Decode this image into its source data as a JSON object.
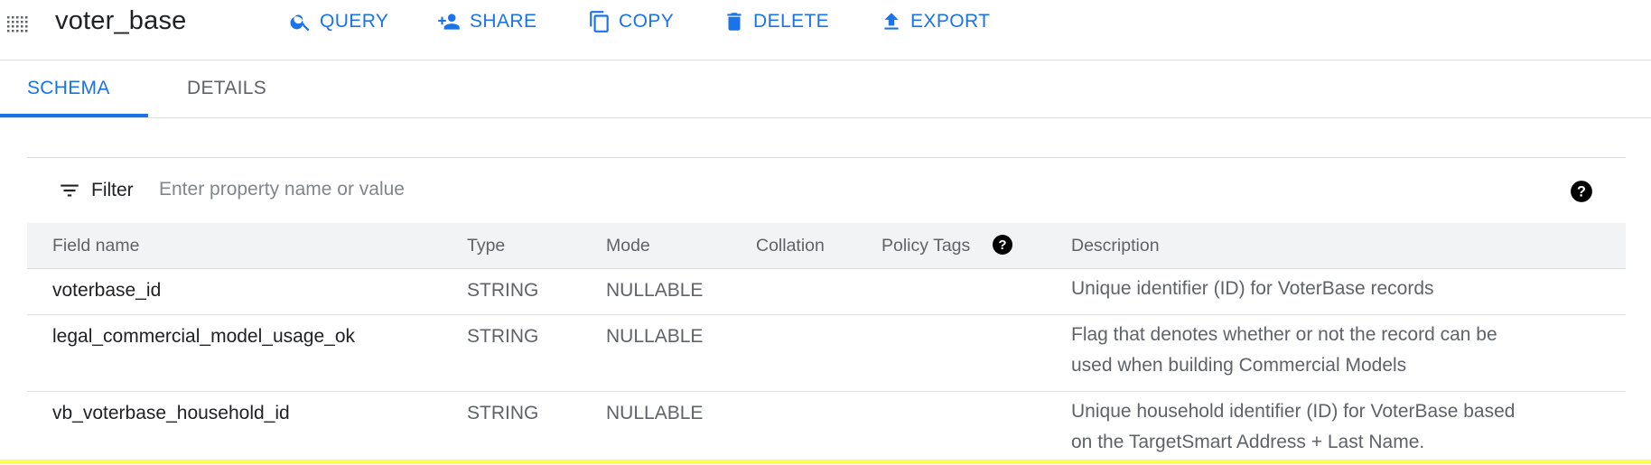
{
  "toolbar": {
    "title": "voter_base",
    "actions": [
      {
        "label": "QUERY",
        "icon": "search-icon"
      },
      {
        "label": "SHARE",
        "icon": "person-add-icon"
      },
      {
        "label": "COPY",
        "icon": "copy-icon"
      },
      {
        "label": "DELETE",
        "icon": "trash-icon"
      },
      {
        "label": "EXPORT",
        "icon": "upload-icon"
      }
    ]
  },
  "tabs": [
    {
      "label": "SCHEMA",
      "active": true
    },
    {
      "label": "DETAILS",
      "active": false
    }
  ],
  "filter": {
    "label": "Filter",
    "placeholder": "Enter property name or value"
  },
  "table": {
    "headers": {
      "field_name": "Field name",
      "type": "Type",
      "mode": "Mode",
      "collation": "Collation",
      "policy_tags": "Policy Tags",
      "description": "Description"
    },
    "rows": [
      {
        "field_name": "voterbase_id",
        "type": "STRING",
        "mode": "NULLABLE",
        "collation": "",
        "policy_tags": "",
        "description": "Unique identifier (ID) for VoterBase records"
      },
      {
        "field_name": "legal_commercial_model_usage_ok",
        "type": "STRING",
        "mode": "NULLABLE",
        "collation": "",
        "policy_tags": "",
        "description": "Flag that denotes whether or not the record can be used when building Commercial Models"
      },
      {
        "field_name": "vb_voterbase_household_id",
        "type": "STRING",
        "mode": "NULLABLE",
        "collation": "",
        "policy_tags": "",
        "description": "Unique household identifier (ID) for VoterBase based on the TargetSmart Address + Last Name."
      }
    ]
  },
  "colors": {
    "accent": "#1a73e8",
    "header_bg": "#f1f3f4",
    "muted_text": "#5f6368",
    "highlight_line": "#fdfd56"
  }
}
